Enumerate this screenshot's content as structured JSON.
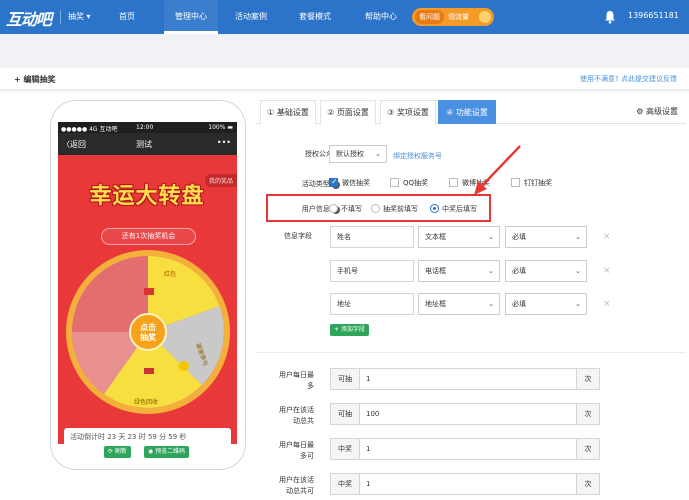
{
  "nav": {
    "logo": "互动吧",
    "selector": "抽奖 ▾",
    "items": [
      "首页",
      "管理中心",
      "活动案例",
      "套餐模式",
      "帮助中心"
    ],
    "promo_pill": "看问题",
    "promo_text": "领流量",
    "account": "1396651181"
  },
  "header": {
    "breadcrumb": "+ 编辑抽奖",
    "feedback": "使用不满意? 点此提交建议反馈"
  },
  "phone": {
    "status_left": "●●●●● 4G 互动吧",
    "status_time": "12:00",
    "status_right": "100% ▬",
    "back": "〈返回",
    "title": "测试",
    "more": "•••",
    "my_prize": "我的奖品",
    "big_title": "幸运大转盘",
    "chances": "还有1次抽奖机会",
    "center_button": "点击抽奖",
    "segments": [
      "红包",
      "谢谢参与",
      "绿色回收"
    ],
    "bottom_text": "活动倒计时 23 天 23 时 59 分 59 秒",
    "refresh": "⟳ 刷新",
    "preview": "◉ 预览二维码"
  },
  "tabs": [
    {
      "label": "① 基础设置"
    },
    {
      "label": "② 页面设置"
    },
    {
      "label": "③ 奖项设置"
    },
    {
      "label": "④ 功能设置"
    }
  ],
  "tab_advanced": "⚙ 高级设置",
  "form": {
    "auth_label": "授权公众号",
    "auth_value": "默认授权",
    "auth_link": "绑定授权服务号",
    "type_label": "活动类型",
    "types": [
      "微信抽奖",
      "QQ抽奖",
      "微博抽奖",
      "钉钉抽奖"
    ],
    "userinfo_label": "用户信息",
    "userinfo_options": [
      "不填写",
      "抽奖前填写",
      "中奖后填写"
    ],
    "fields_label": "信息字段",
    "fields": [
      {
        "name": "姓名",
        "type": "文本框",
        "req": "必填"
      },
      {
        "name": "手机号",
        "type": "电话框",
        "req": "必填"
      },
      {
        "name": "地址",
        "type": "地址框",
        "req": "必填"
      }
    ],
    "add_field": "+ 添加字段",
    "limits": [
      {
        "label1": "用户每日最",
        "label2": "多",
        "prefix": "可抽",
        "value": "1",
        "unit": "次"
      },
      {
        "label1": "用户在该活",
        "label2": "动总共",
        "prefix": "可抽",
        "value": "100",
        "unit": "次"
      },
      {
        "label1": "用户每日最",
        "label2": "多可",
        "prefix": "中奖",
        "value": "1",
        "unit": "次"
      },
      {
        "label1": "用户在该活",
        "label2": "动总共可",
        "prefix": "中奖",
        "value": "1",
        "unit": "次"
      }
    ]
  }
}
